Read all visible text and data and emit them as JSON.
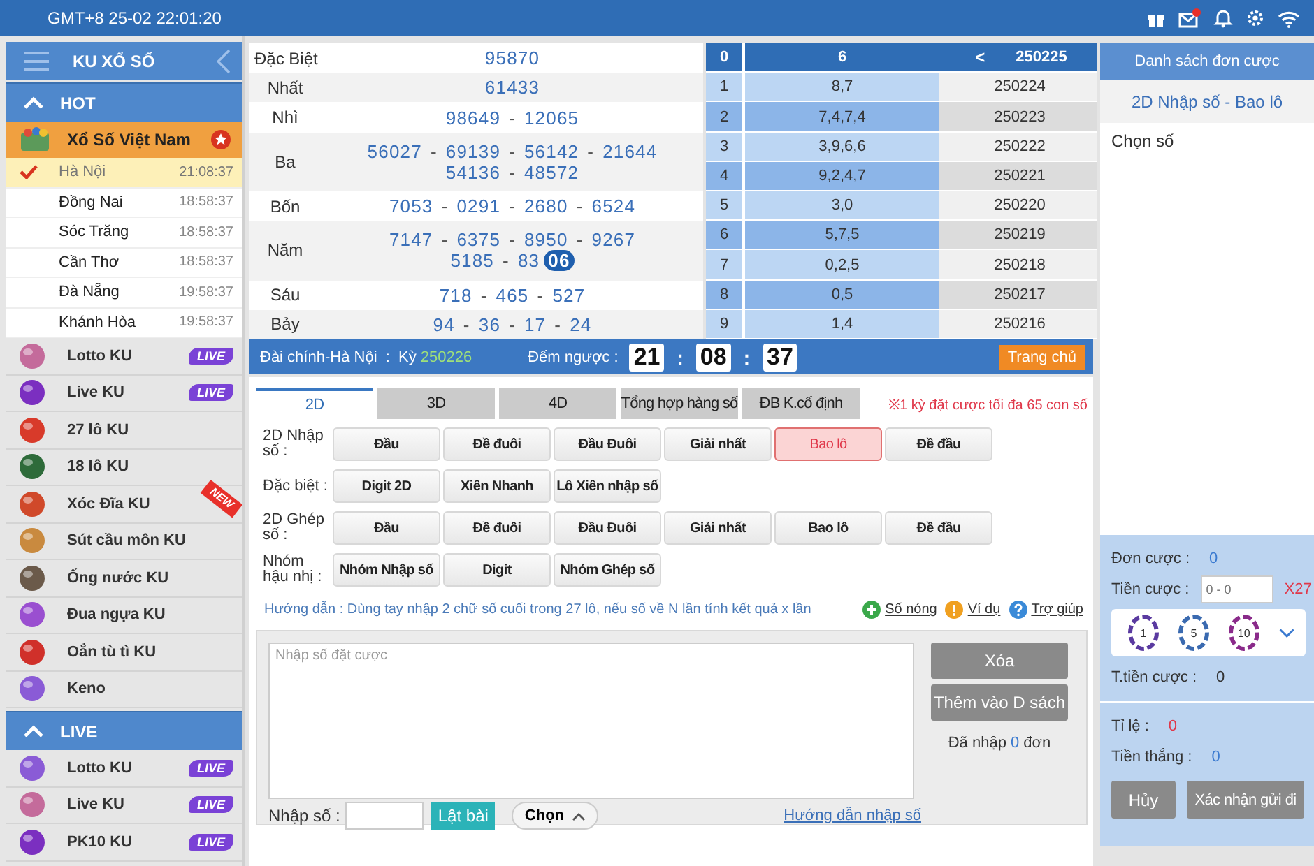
{
  "top_bar": {
    "clock": "GMT+8 25-02 22:01:20"
  },
  "sidebar": {
    "title": "KU XỔ SỐ",
    "sections": [
      {
        "title": "HOT",
        "expanded": true,
        "items": [
          {
            "kind": "group",
            "label": "Xổ Số Việt Nam",
            "expanded": true,
            "children": [
              {
                "label": "Hà Nội",
                "time": "21:08:37",
                "selected": true
              },
              {
                "label": "Đồng Nai",
                "time": "18:58:37",
                "selected": false
              },
              {
                "label": "Sóc Trăng",
                "time": "18:58:37",
                "selected": false
              },
              {
                "label": "Cần Thơ",
                "time": "18:58:37",
                "selected": false
              },
              {
                "label": "Đà Nẵng",
                "time": "19:58:37",
                "selected": false
              },
              {
                "label": "Khánh Hòa",
                "time": "19:58:37",
                "selected": false
              }
            ]
          },
          {
            "kind": "game",
            "label": "Lotto KU",
            "badge": "LIVE"
          },
          {
            "kind": "game",
            "label": "Live KU",
            "badge": "LIVE"
          },
          {
            "kind": "game",
            "label": "27 lô KU"
          },
          {
            "kind": "game",
            "label": "18 lô KU"
          },
          {
            "kind": "game",
            "label": "Xóc Đĩa KU",
            "ribbon": "NEW"
          },
          {
            "kind": "game",
            "label": "Sút cầu môn KU"
          },
          {
            "kind": "game",
            "label": "Ống nước KU"
          },
          {
            "kind": "game",
            "label": "Đua ngựa KU"
          },
          {
            "kind": "game",
            "label": "Oẳn tù tì KU"
          },
          {
            "kind": "game",
            "label": "Keno"
          }
        ]
      },
      {
        "title": "LIVE",
        "expanded": true,
        "items": [
          {
            "kind": "game",
            "label": "Lotto KU",
            "badge": "LIVE"
          },
          {
            "kind": "game",
            "label": "Live KU",
            "badge": "LIVE"
          },
          {
            "kind": "game",
            "label": "PK10 KU",
            "badge": "LIVE"
          }
        ]
      }
    ]
  },
  "results": {
    "separator": "-",
    "prizes": [
      {
        "label": "Đặc Biệt",
        "lines": [
          [
            {
              "n": "95870",
              "hot": false
            }
          ]
        ]
      },
      {
        "label": "Nhất",
        "lines": [
          [
            {
              "n": "61433",
              "hot": false
            }
          ]
        ]
      },
      {
        "label": "Nhì",
        "lines": [
          [
            {
              "n": "98649",
              "hot": false
            },
            {
              "n": "12065",
              "hot": false
            }
          ]
        ]
      },
      {
        "label": "Ba",
        "lines": [
          [
            {
              "n": "56027",
              "hot": false
            },
            {
              "n": "69139",
              "hot": false
            },
            {
              "n": "56142",
              "hot": false
            },
            {
              "n": "21644",
              "hot": false
            }
          ],
          [
            {
              "n": "54136",
              "hot": false
            },
            {
              "n": "48572",
              "hot": false
            }
          ]
        ]
      },
      {
        "label": "Bốn",
        "lines": [
          [
            {
              "n": "7053",
              "hot": false
            },
            {
              "n": "0291",
              "hot": false
            },
            {
              "n": "2680",
              "hot": false
            },
            {
              "n": "6524",
              "hot": false
            }
          ]
        ]
      },
      {
        "label": "Năm",
        "lines": [
          [
            {
              "n": "7147",
              "hot": false
            },
            {
              "n": "6375",
              "hot": false
            },
            {
              "n": "8950",
              "hot": false
            },
            {
              "n": "9267",
              "hot": false
            }
          ],
          [
            {
              "n": "5185",
              "hot": false
            },
            {
              "n": "83",
              "hot": false
            },
            {
              "n": "06",
              "hot": true
            }
          ]
        ]
      },
      {
        "label": "Sáu",
        "lines": [
          [
            {
              "n": "718",
              "hot": false
            },
            {
              "n": "465",
              "hot": false
            },
            {
              "n": "527",
              "hot": false
            }
          ]
        ]
      },
      {
        "label": "Bảy",
        "lines": [
          [
            {
              "n": "94",
              "hot": false
            },
            {
              "n": "36",
              "hot": false
            },
            {
              "n": "17",
              "hot": false
            },
            {
              "n": "24",
              "hot": false
            }
          ]
        ]
      }
    ]
  },
  "digits": {
    "prev_label": "<",
    "rows": [
      {
        "digit": "0",
        "numbers": "6",
        "draw": "250225",
        "selected": true
      },
      {
        "digit": "1",
        "numbers": "8,7",
        "draw": "250224",
        "selected": false
      },
      {
        "digit": "2",
        "numbers": "7,4,7,4",
        "draw": "250223",
        "selected": false
      },
      {
        "digit": "3",
        "numbers": "3,9,6,6",
        "draw": "250222",
        "selected": false
      },
      {
        "digit": "4",
        "numbers": "9,2,4,7",
        "draw": "250221",
        "selected": false
      },
      {
        "digit": "5",
        "numbers": "3,0",
        "draw": "250220",
        "selected": false
      },
      {
        "digit": "6",
        "numbers": "5,7,5",
        "draw": "250219",
        "selected": false
      },
      {
        "digit": "7",
        "numbers": "0,2,5",
        "draw": "250218",
        "selected": false
      },
      {
        "digit": "8",
        "numbers": "0,5",
        "draw": "250217",
        "selected": false
      },
      {
        "digit": "9",
        "numbers": "1,4",
        "draw": "250216",
        "selected": false
      }
    ]
  },
  "info_bar": {
    "station": "Đài chính-Hà Nội  :  Kỳ",
    "period": "250226",
    "countdown_label": "Đếm ngược :",
    "countdown": [
      "21",
      "08",
      "37"
    ],
    "countdown_separator": ":",
    "home_button": "Trang chủ"
  },
  "bet": {
    "tabs": [
      {
        "label": "2D",
        "selected": true
      },
      {
        "label": "3D",
        "selected": false
      },
      {
        "label": "4D",
        "selected": false
      },
      {
        "label": "Tổng hợp hàng số",
        "selected": false
      },
      {
        "label": "ĐB K.cố định",
        "selected": false
      }
    ],
    "note": "※1 kỳ đặt cược tối đa 65 con số",
    "groups": [
      {
        "label": "2D Nhập số :",
        "options": [
          {
            "label": "Đầu",
            "selected": false
          },
          {
            "label": "Đề đuôi",
            "selected": false
          },
          {
            "label": "Đầu Đuôi",
            "selected": false
          },
          {
            "label": "Giải nhất",
            "selected": false
          },
          {
            "label": "Bao lô",
            "selected": true
          },
          {
            "label": "Đề đầu",
            "selected": false
          }
        ]
      },
      {
        "label": "Đặc biệt :",
        "options": [
          {
            "label": "Digit 2D",
            "selected": false
          },
          {
            "label": "Xiên Nhanh",
            "selected": false
          },
          {
            "label": "Lô Xiên nhập số",
            "selected": false
          }
        ]
      },
      {
        "label": "2D Ghép số :",
        "options": [
          {
            "label": "Đầu",
            "selected": false
          },
          {
            "label": "Đề đuôi",
            "selected": false
          },
          {
            "label": "Đầu Đuôi",
            "selected": false
          },
          {
            "label": "Giải nhất",
            "selected": false
          },
          {
            "label": "Bao lô",
            "selected": false
          },
          {
            "label": "Đề đầu",
            "selected": false
          }
        ]
      },
      {
        "label": "Nhóm hậu nhị :",
        "options": [
          {
            "label": "Nhóm Nhập số",
            "selected": false
          },
          {
            "label": "Digit",
            "selected": false
          },
          {
            "label": "Nhóm Ghép số",
            "selected": false
          }
        ]
      }
    ],
    "guide": "Hướng dẫn : Dùng tay nhập 2 chữ số cuối trong 27 lô, nếu số về N lần tính kết quả x lần",
    "links": [
      {
        "kind": "plus",
        "label": "Số nóng"
      },
      {
        "kind": "warn",
        "label": "Ví dụ"
      },
      {
        "kind": "help",
        "label": "Trợ giúp"
      }
    ],
    "input_placeholder": "Nhập số đặt cược",
    "clear_button": "Xóa",
    "add_button": "Thêm vào D sách",
    "entered": {
      "prefix": "Đã nhập",
      "count": "0",
      "suffix": "đơn"
    },
    "number_label": "Nhập số :",
    "flip_button": "Lật bài",
    "choose_button": "Chọn",
    "howto_link": "Hướng dẫn nhập số"
  },
  "slip": {
    "title": "Danh sách đơn cược",
    "bet_type": "2D Nhập số - Bao lô",
    "pick_label": "Chọn số",
    "orders_label": "Đơn cược :",
    "orders": "0",
    "stake_label": "Tiền cược :",
    "stake_placeholder": "0 - 0",
    "multiplier": "X27",
    "chips": [
      "1",
      "5",
      "10"
    ],
    "total_label": "T.tiền cược :",
    "total": "0",
    "rate_label": "Tỉ lệ :",
    "rate": "0",
    "win_label": "Tiền thắng :",
    "win": "0",
    "cancel_button": "Hủy",
    "confirm_button": "Xác nhận gửi đi"
  }
}
